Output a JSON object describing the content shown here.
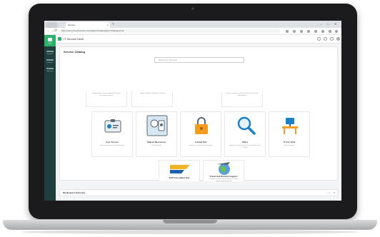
{
  "browser": {
    "tab_active_label": "Service",
    "url": "https://demo.freshservice.com/support/catalog/items?category=all",
    "nav": {
      "back": "←",
      "forward": "→",
      "reload": "⟳"
    }
  },
  "app": {
    "title": "IT Service Desk"
  },
  "sidebar": {
    "items": [
      "Home",
      "Requests",
      "Solutions",
      "Approvals"
    ]
  },
  "catalog": {
    "title": "Service Catalog",
    "search_placeholder": "Search for Services",
    "partial_row": [
      {
        "desc": "Request laptop, monitor, keyboard and other accessories for work."
      },
      {
        "desc": "Request software installation or license."
      },
      {
        "desc": "Request access to specific network resources and shared folders."
      }
    ],
    "cards": [
      {
        "label": "User Access",
        "desc": "Get new user access and permissions",
        "icon": "id-card-icon"
      },
      {
        "label": "Shared Resources",
        "desc": "Get file storage",
        "icon": "shared-resource-icon"
      },
      {
        "label": "Locked Out",
        "desc": "Get your account reset and unlocked",
        "icon": "padlock-icon"
      },
      {
        "label": "Other",
        "desc": "Request any other service that is not listed in the catalog",
        "icon": "magnifier-icon"
      },
      {
        "label": "IT Use Only",
        "desc": "For IT purposes",
        "icon": "desk-icon"
      },
      {
        "label": "SAP Consultant Kits",
        "desc": "",
        "icon": "sap-icon"
      },
      {
        "label": "Travel and Remote Support",
        "desc": "Get remote support while on travel and request support for your travel kit",
        "icon": "travel-globe-icon"
      }
    ]
  },
  "footer": {
    "title": "My Request Summary"
  },
  "colors": {
    "sidebar": "#1e3f3d",
    "accent": "#2db26b",
    "lock": "#f39c1f",
    "magnifier": "#1d7fc4",
    "sap": "#f0b323"
  }
}
